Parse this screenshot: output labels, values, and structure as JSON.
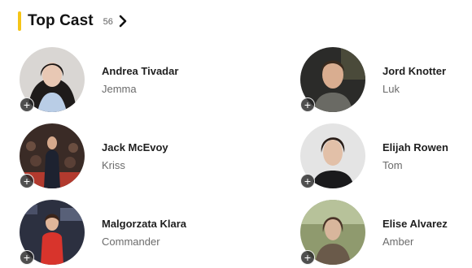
{
  "section": {
    "title": "Top Cast",
    "count": "56",
    "accent_color": "#f5c518",
    "more_icon": "chevron-right-icon"
  },
  "cast": [
    {
      "name": "Andrea Tivadar",
      "character": "Jemma",
      "add_icon": "plus-icon"
    },
    {
      "name": "Jord Knotter",
      "character": "Luk",
      "add_icon": "plus-icon"
    },
    {
      "name": "Jack McEvoy",
      "character": "Kriss",
      "add_icon": "plus-icon"
    },
    {
      "name": "Elijah Rowen",
      "character": "Tom",
      "add_icon": "plus-icon"
    },
    {
      "name": "Malgorzata Klara",
      "character": "Commander",
      "add_icon": "plus-icon"
    },
    {
      "name": "Elise Alvarez",
      "character": "Amber",
      "add_icon": "plus-icon"
    }
  ]
}
